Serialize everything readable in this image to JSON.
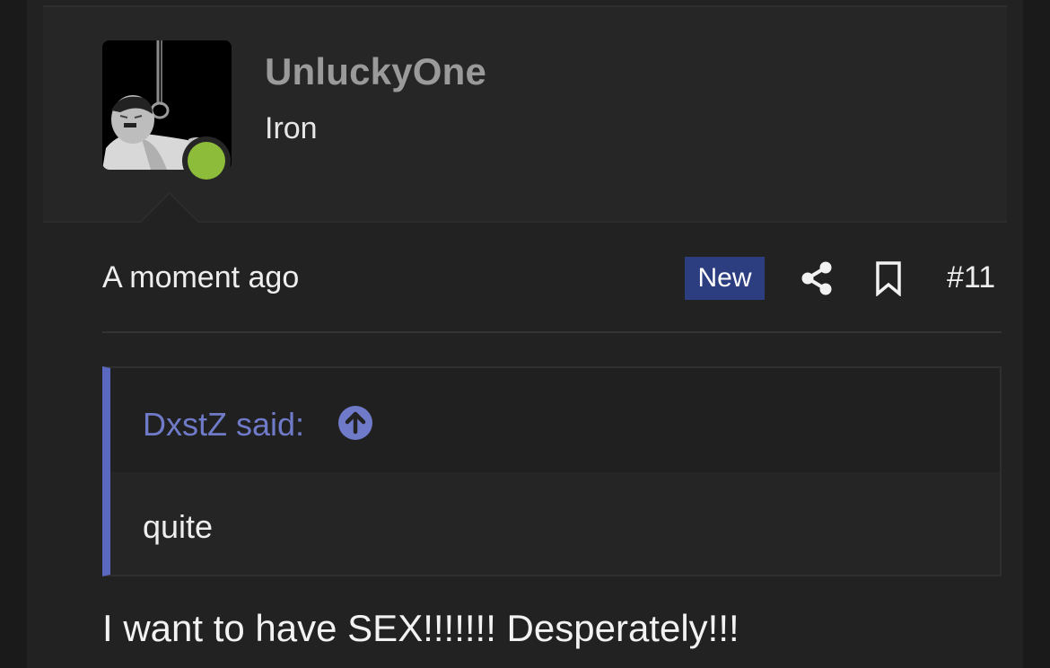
{
  "post": {
    "username": "UnluckyOne",
    "user_title": "Iron",
    "time": "A moment ago",
    "badge": "New",
    "number": "#11",
    "quote": {
      "author": "DxstZ said:",
      "body": "quite"
    },
    "message": "I want to have SEX!!!!!!! Desperately!!!"
  },
  "icons": {
    "share": "share-icon",
    "bookmark": "bookmark-icon",
    "quote_up": "arrow-up-circle-icon",
    "online": "online-status-dot"
  },
  "colors": {
    "background": "#1a1a1a",
    "post_bg": "#222222",
    "username": "#9a9a9a",
    "badge_bg": "#2c3e80",
    "quote_accent": "#5b68c0",
    "online": "#8dbb3a"
  }
}
